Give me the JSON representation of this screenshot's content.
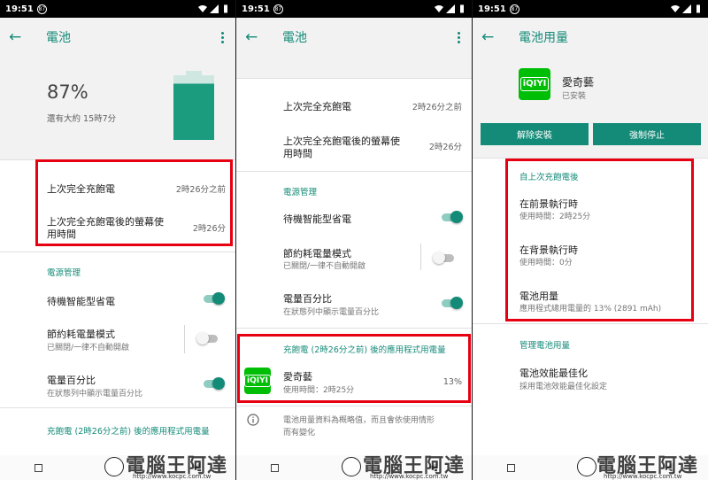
{
  "status_bar": {
    "time": "19:51",
    "notification_badge": "87"
  },
  "colors": {
    "accent": "#138b78",
    "battery": "#1b9c7f",
    "highlight": "#e60012",
    "iqiyi": "#00be06"
  },
  "screen1": {
    "title": "電池",
    "battery_percent": "87%",
    "remaining": "還有大約 15時7分",
    "battery_level": 0.87,
    "last_full_charge_label": "上次完全充飽電",
    "last_full_charge_value": "2時26分之前",
    "screen_usage_label_line1": "上次完全充飽電後的螢幕使",
    "screen_usage_label_line2": "用時間",
    "screen_usage_value": "2時26分",
    "power_mgmt_header": "電源管理",
    "smart_battery_label": "待機智能型省電",
    "saver_label": "節約耗電量模式",
    "saver_sub": "已關閉/一律不自動開啟",
    "percent_label": "電量百分比",
    "percent_sub": "在狀態列中顯示電量百分比",
    "app_usage_header": "充飽電 (2時26分之前) 後的應用程式用電量"
  },
  "screen2": {
    "title": "電池",
    "last_full_charge_label": "上次完全充飽電",
    "last_full_charge_value": "2時26分之前",
    "screen_usage_label_line1": "上次完全充飽電後的螢幕使",
    "screen_usage_label_line2": "用時間",
    "screen_usage_value": "2時26分",
    "power_mgmt_header": "電源管理",
    "smart_battery_label": "待機智能型省電",
    "saver_label": "節約耗電量模式",
    "saver_sub": "已關閉/一律不自動開啟",
    "percent_label": "電量百分比",
    "percent_sub": "在狀態列中顯示電量百分比",
    "app_usage_header": "充飽電 (2時26分之前) 後的應用程式用電量",
    "app_name": "愛奇藝",
    "app_usage": "使用時間：2時25分",
    "app_percent": "13%",
    "info_line1": "電池用量資料為概略值，而且會依使用情形",
    "info_line2": "而有變化"
  },
  "screen3": {
    "title": "電池用量",
    "app_name": "愛奇藝",
    "app_status": "已安裝",
    "uninstall": "解除安裝",
    "force_stop": "強制停止",
    "since_header": "自上次充飽電後",
    "foreground_label": "在前景執行時",
    "foreground_sub": "使用時間：2時25分",
    "background_label": "在背景執行時",
    "background_sub": "使用時間：0分",
    "usage_label": "電池用量",
    "usage_sub": "應用程式總用電量的 13% (2891 mAh)",
    "manage_header": "管理電池用量",
    "optimize_label": "電池效能最佳化",
    "optimize_sub": "採用電池效能最佳化設定"
  },
  "app_icon_text": "iQIYI",
  "watermark": {
    "text": "電腦王阿達",
    "url": "http://www.kocpc.com.tw"
  }
}
